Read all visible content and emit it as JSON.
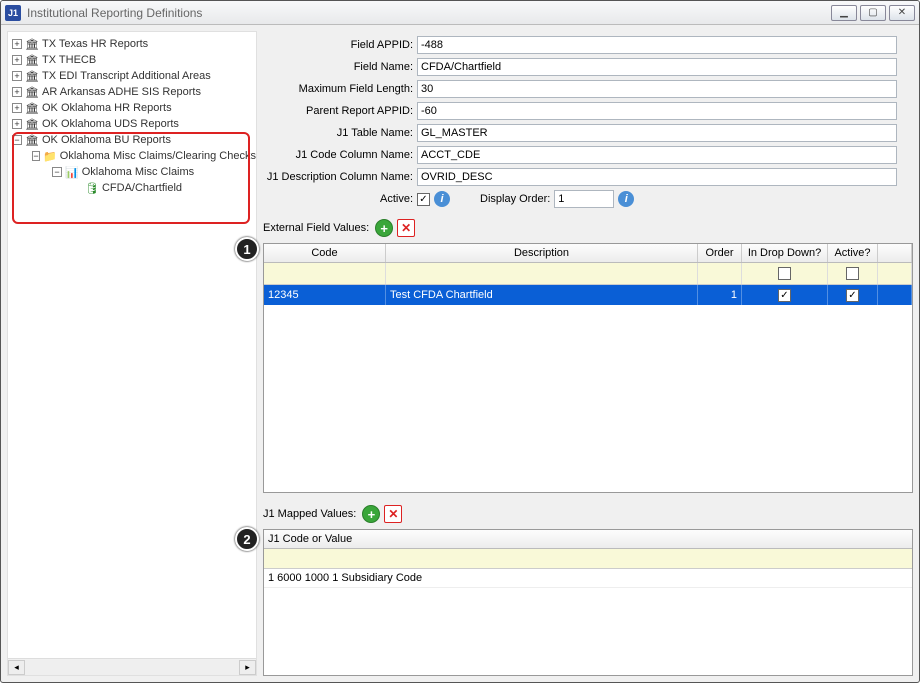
{
  "window": {
    "logo": "J1",
    "title": "Institutional Reporting Definitions"
  },
  "tree": {
    "items": [
      {
        "label": "TX Texas HR Reports"
      },
      {
        "label": "TX THECB"
      },
      {
        "label": "TX EDI Transcript Additional Areas"
      },
      {
        "label": "AR Arkansas ADHE SIS Reports"
      },
      {
        "label": "OK Oklahoma HR Reports"
      },
      {
        "label": "OK Oklahoma UDS Reports"
      },
      {
        "label": "OK Oklahoma BU Reports"
      }
    ],
    "sub1": "Oklahoma Misc Claims/Clearing Checks",
    "sub2": "Oklahoma Misc Claims",
    "sub3": "CFDA/Chartfield"
  },
  "form": {
    "field_appid_label": "Field APPID:",
    "field_appid": "-488",
    "field_name_label": "Field Name:",
    "field_name": "CFDA/Chartfield",
    "max_len_label": "Maximum Field Length:",
    "max_len": "30",
    "parent_appid_label": "Parent Report APPID:",
    "parent_appid": "-60",
    "table_name_label": "J1  Table Name:",
    "table_name": "GL_MASTER",
    "code_col_label": "J1 Code Column Name:",
    "code_col": "ACCT_CDE",
    "desc_col_label": "J1  Description Column Name:",
    "desc_col": "OVRID_DESC",
    "active_label": "Active:",
    "display_order_label": "Display Order:",
    "display_order": "1"
  },
  "ext_values": {
    "title": "External Field Values:",
    "headers": {
      "code": "Code",
      "desc": "Description",
      "order": "Order",
      "dropdown": "In Drop Down?",
      "active": "Active?"
    },
    "row": {
      "code": "12345",
      "desc": "Test CFDA Chartfield",
      "order": "1",
      "dropdown": true,
      "active": true
    }
  },
  "mapped": {
    "title": "J1 Mapped Values:",
    "header": "J1  Code or Value",
    "row": "1    6000 1000 1   Subsidiary Code"
  },
  "callouts": {
    "one": "1",
    "two": "2"
  }
}
